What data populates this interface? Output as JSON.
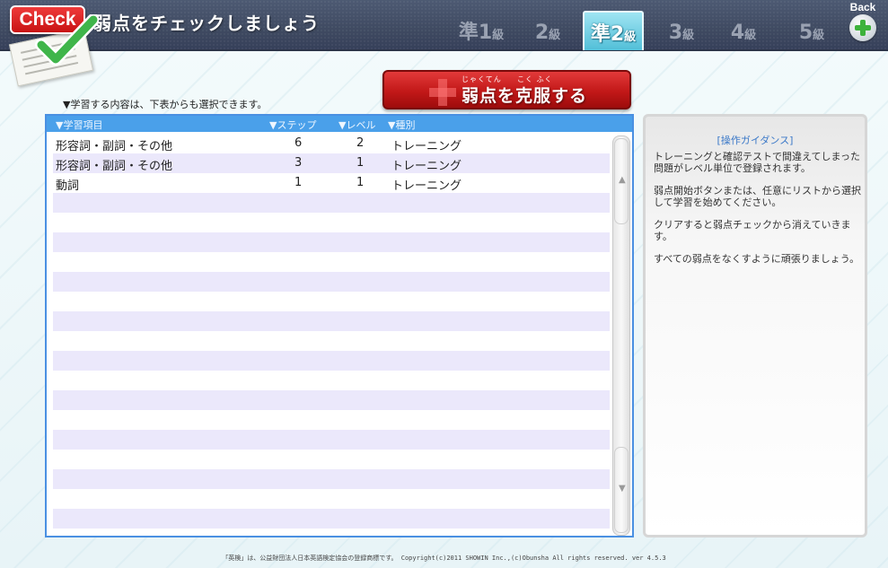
{
  "header": {
    "logo_text": "Check",
    "title": "弱点をチェックしましょう",
    "back_label": "Back",
    "grades": [
      {
        "label": "準1級",
        "num": "準1",
        "suffix": "級",
        "active": false
      },
      {
        "label": "2級",
        "num": "2",
        "suffix": "級",
        "active": false
      },
      {
        "label": "準2級",
        "num": "準2",
        "suffix": "級",
        "active": true
      },
      {
        "label": "3級",
        "num": "3",
        "suffix": "級",
        "active": false
      },
      {
        "label": "4級",
        "num": "4",
        "suffix": "級",
        "active": false
      },
      {
        "label": "5級",
        "num": "5",
        "suffix": "級",
        "active": false
      }
    ]
  },
  "instruction": "▼学習する内容は、下表からも選択できます。",
  "conquer_button": {
    "label": "弱点を克服する",
    "ruby_left": "じゃくてん",
    "ruby_right": "こく ふく"
  },
  "table": {
    "columns": {
      "item": "▼学習項目",
      "step": "▼ステップ",
      "level": "▼レベル",
      "type": "▼種別"
    },
    "rows": [
      {
        "item": "形容詞・副詞・その他",
        "step": "6",
        "level": "2",
        "type": "トレーニング"
      },
      {
        "item": "形容詞・副詞・その他",
        "step": "3",
        "level": "1",
        "type": "トレーニング"
      },
      {
        "item": "動詞",
        "step": "1",
        "level": "1",
        "type": "トレーニング"
      }
    ]
  },
  "guide": {
    "title": "[操作ガイダンス]",
    "paragraphs": [
      "トレーニングと確認テストで間違えてしまった問題がレベル単位で登録されます。",
      "弱点開始ボタンまたは、任意にリストから選択して学習を始めてください。",
      "クリアすると弱点チェックから消えていきます。",
      "すべての弱点をなくすように頑張りましょう。"
    ]
  },
  "footer": "「英検」は、公益財団法人日本英語検定協会の登録商標です。  Copyright(c)2011 SHOWIN Inc.,(c)Obunsha All rights reserved. ver 4.5.3",
  "colors": {
    "header_bg": "#414c64",
    "active_grade": "#52bfd8",
    "conquer_red": "#c21818",
    "table_header": "#4aa0ea",
    "row_stripe": "#ebe8fb",
    "guide_title": "#3a78c8"
  },
  "icons": {
    "logo": "check-mark-icon",
    "back": "plus-circle-icon",
    "scroll_up": "arrow-up-icon",
    "scroll_down": "arrow-down-icon"
  }
}
